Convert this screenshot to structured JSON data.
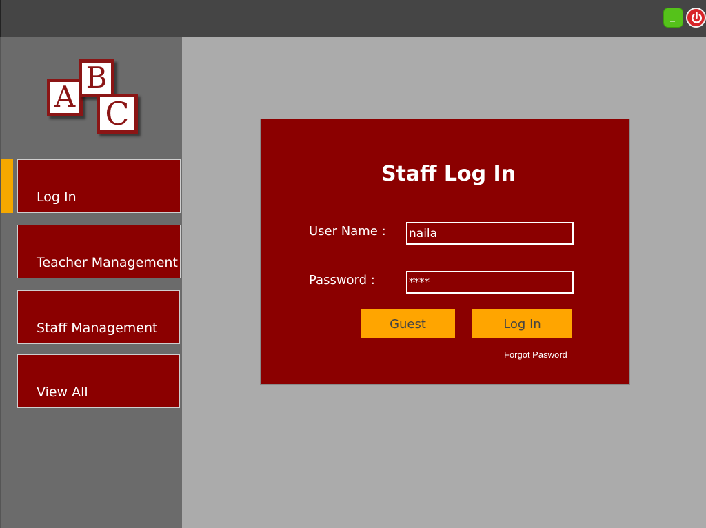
{
  "window_controls": {
    "minimize_glyph": "_",
    "minimize_color": "#55c21a",
    "close_color": "#d7262a",
    "close_icon": "power-icon"
  },
  "logo": {
    "letters": [
      "A",
      "B",
      "C"
    ],
    "color": "#8b1515"
  },
  "sidebar": {
    "active_index": 0,
    "accent_color": "#f5a800",
    "items": [
      {
        "label": "Log In"
      },
      {
        "label": "Teacher Management"
      },
      {
        "label": "Staff Management"
      },
      {
        "label": "View All"
      }
    ]
  },
  "login": {
    "title": "Staff Log In",
    "username_label": "User Name :",
    "username_value": "naila",
    "password_label": "Password :",
    "password_value": "****",
    "guest_label": "Guest",
    "login_label": "Log In",
    "forgot_label": "Forgot Pasword",
    "panel_color": "#8b0000",
    "button_color": "#ffa500"
  }
}
